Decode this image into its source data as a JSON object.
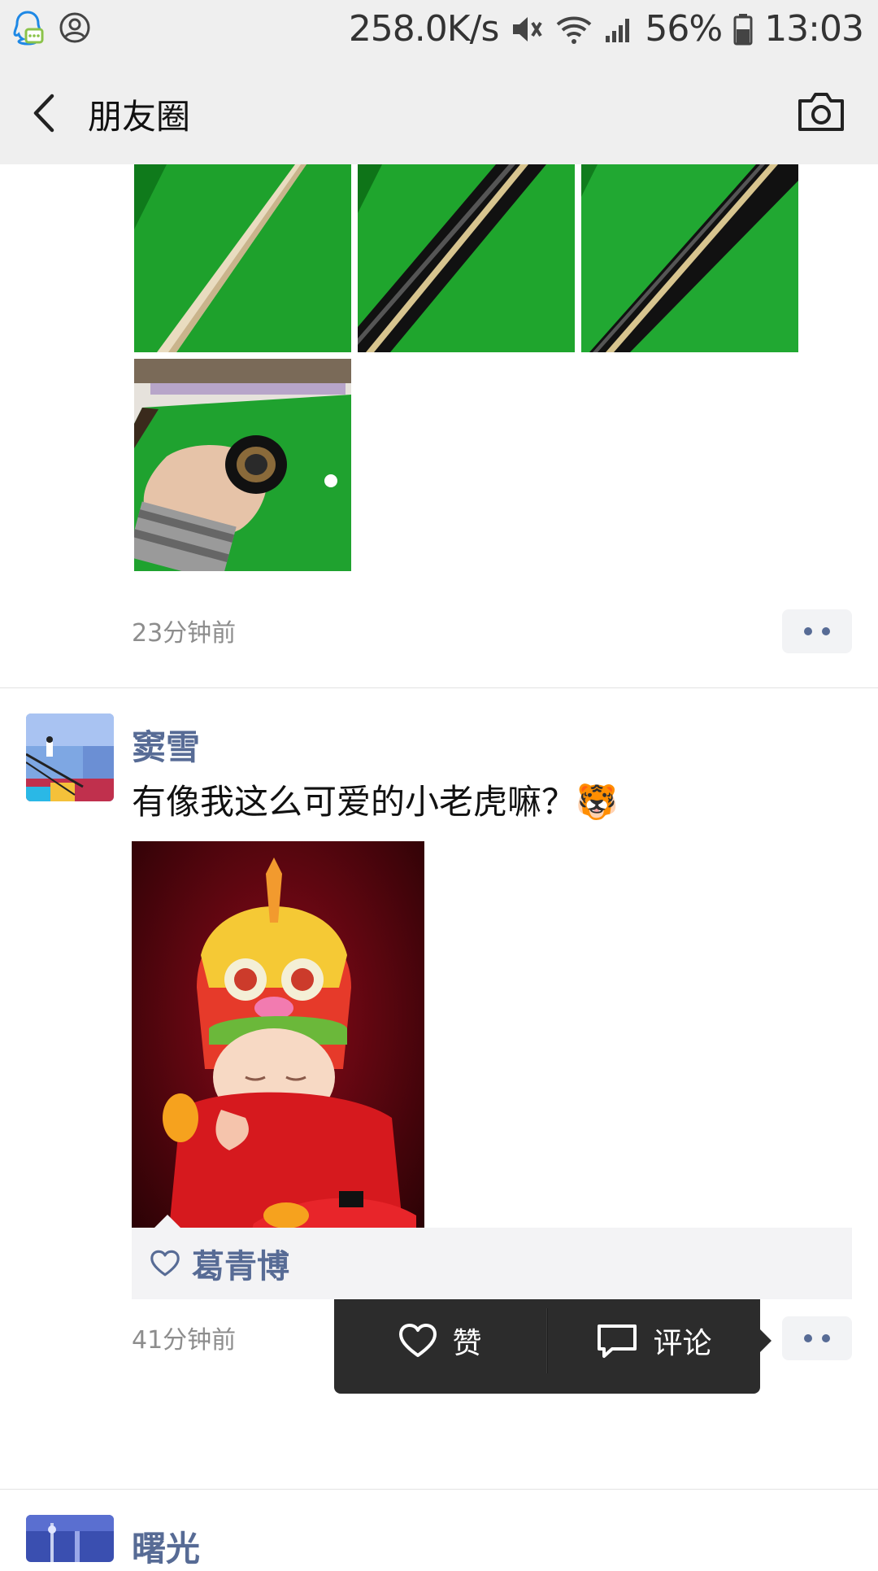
{
  "status_bar": {
    "net_speed": "258.0K/s",
    "battery": "56%",
    "time": "13:03",
    "icons": [
      "qq-notify-icon",
      "account-circle-icon",
      "mute-icon",
      "wifi-icon",
      "signal-icon",
      "battery-icon"
    ]
  },
  "header": {
    "title": "朋友圈",
    "back_icon": "chevron-left-icon",
    "camera_icon": "camera-icon"
  },
  "posts": [
    {
      "images": [
        "cue-stick-light-wood",
        "cue-stick-dark-1",
        "cue-stick-dark-2",
        "cue-butt-in-hand"
      ],
      "time": "23分钟前"
    },
    {
      "author": "窦雪",
      "text": "有像我这么可爱的小老虎嘛？🐯",
      "images": [
        "baby-in-tiger-hat"
      ],
      "time": "41分钟前",
      "actions": {
        "like_label": "赞",
        "comment_label": "评论"
      },
      "likes": [
        "葛青博"
      ]
    },
    {
      "author": "曙光"
    }
  ],
  "colors": {
    "link_blue": "#576b95",
    "bar_gray": "#efefef",
    "popup_dark": "#2c2c2c"
  }
}
